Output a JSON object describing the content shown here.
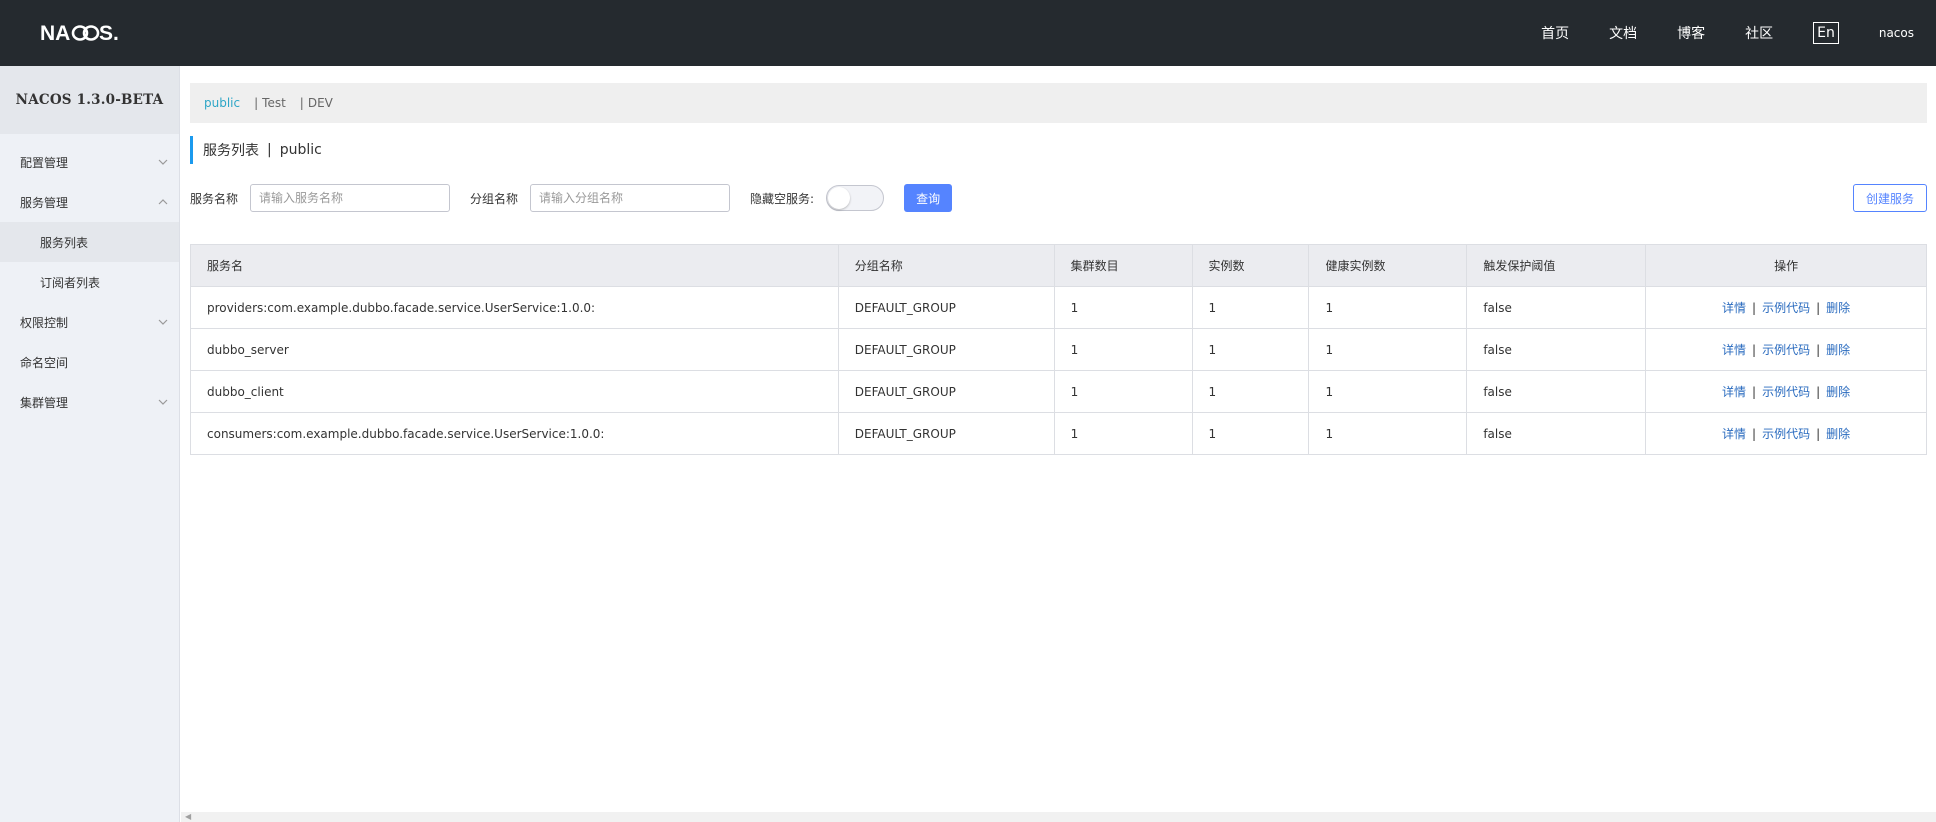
{
  "header": {
    "logo_text": "NACOS.",
    "nav": [
      "首页",
      "文档",
      "博客",
      "社区"
    ],
    "lang_button": "En",
    "user": "nacos"
  },
  "sidebar": {
    "version": "NACOS 1.3.0-BETA",
    "menu": [
      {
        "label": "配置管理",
        "expanded": false
      },
      {
        "label": "服务管理",
        "expanded": true,
        "children": [
          {
            "label": "服务列表",
            "active": true
          },
          {
            "label": "订阅者列表",
            "active": false
          }
        ]
      },
      {
        "label": "权限控制",
        "expanded": false
      },
      {
        "label": "命名空间"
      },
      {
        "label": "集群管理",
        "expanded": false
      }
    ]
  },
  "namespaces": {
    "items": [
      "public",
      "Test",
      "DEV"
    ],
    "active": "public",
    "separator": "|"
  },
  "page": {
    "title": "服务列表",
    "separator": "|",
    "namespace": "public"
  },
  "filters": {
    "service_name_label": "服务名称",
    "service_name_placeholder": "请输入服务名称",
    "group_name_label": "分组名称",
    "group_name_placeholder": "请输入分组名称",
    "hide_empty_label": "隐藏空服务:",
    "hide_empty_value": false,
    "query_button": "查询",
    "create_button": "创建服务"
  },
  "table": {
    "columns": [
      "服务名",
      "分组名称",
      "集群数目",
      "实例数",
      "健康实例数",
      "触发保护阈值",
      "操作"
    ],
    "actions": [
      "详情",
      "示例代码",
      "删除"
    ],
    "action_separator": "|",
    "rows": [
      [
        "providers:com.example.dubbo.facade.service.UserService:1.0.0:",
        "DEFAULT_GROUP",
        "1",
        "1",
        "1",
        "false"
      ],
      [
        "dubbo_server",
        "DEFAULT_GROUP",
        "1",
        "1",
        "1",
        "false"
      ],
      [
        "dubbo_client",
        "DEFAULT_GROUP",
        "1",
        "1",
        "1",
        "false"
      ],
      [
        "consumers:com.example.dubbo.facade.service.UserService:1.0.0:",
        "DEFAULT_GROUP",
        "1",
        "1",
        "1",
        "false"
      ]
    ]
  },
  "colors": {
    "header_bg": "#252a2f",
    "sidebar_bg": "#eef1f6",
    "accent": "#5584ff",
    "link": "#2a6bbf",
    "active_namespace": "#2ea6c7"
  }
}
